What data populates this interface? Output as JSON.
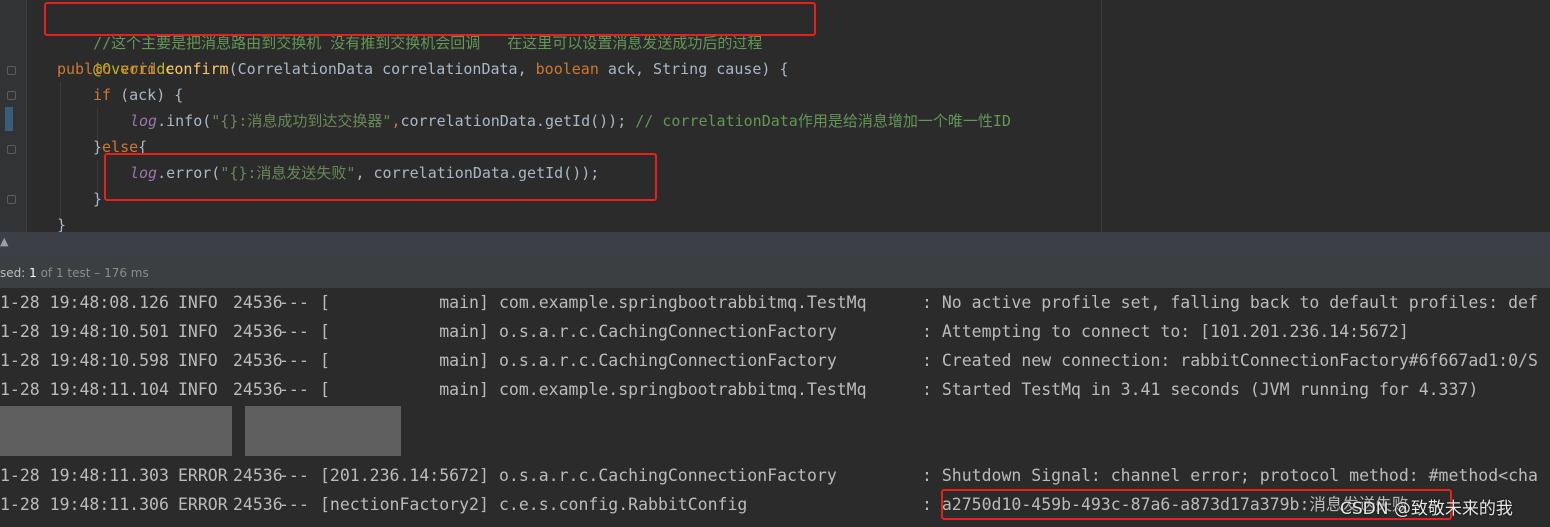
{
  "editor": {
    "lines": {
      "comment": "//这个主要是把消息路由到交换机 没有推到交换机会回调   在这里可以设置消息发送成功后的过程",
      "annotation": "@Override",
      "sig_public": "public",
      "sig_void": "void",
      "sig_name": "confirm",
      "sig_open": "(CorrelationData correlationData, ",
      "sig_boolean": "boolean",
      "sig_rest": " ack, String cause) {",
      "if_kw": "if",
      "if_rest": " (ack) {",
      "info_log": "log",
      "info_call": ".info(",
      "info_str": "\"{}:消息成功到达交换器\"",
      "info_comma": ",",
      "info_args": "correlationData.getId()); ",
      "info_comment": "// correlationData作用是给消息增加一个唯一性ID",
      "else_open": "}",
      "else_kw": "else",
      "else_brace": "{",
      "error_log": "log",
      "error_call": ".error(",
      "error_str": "\"{}:消息发送失败\"",
      "error_args": ", correlationData.getId());",
      "close_if": "}",
      "close_method": "}"
    }
  },
  "status": {
    "label": "sed: ",
    "value": "1",
    "rest": " of 1 test – 176 ms"
  },
  "console": {
    "rows": [
      {
        "date": "1-28 19:48:08.126",
        "level": "INFO",
        "pid": "24536",
        "sep": "---",
        "thread": "[           main]",
        "logger": "com.example.springbootrabbitmq.TestMq",
        "msg": ": No active profile set, falling back to default profiles: def"
      },
      {
        "date": "1-28 19:48:10.501",
        "level": "INFO",
        "pid": "24536",
        "sep": "---",
        "thread": "[           main]",
        "logger": "o.s.a.r.c.CachingConnectionFactory",
        "msg": ": Attempting to connect to: [101.201.236.14:5672]"
      },
      {
        "date": "1-28 19:48:10.598",
        "level": "INFO",
        "pid": "24536",
        "sep": "---",
        "thread": "[           main]",
        "logger": "o.s.a.r.c.CachingConnectionFactory",
        "msg": ": Created new connection: rabbitConnectionFactory#6f667ad1:0/S"
      },
      {
        "date": "1-28 19:48:11.104",
        "level": "INFO",
        "pid": "24536",
        "sep": "---",
        "thread": "[           main]",
        "logger": "com.example.springbootrabbitmq.TestMq",
        "msg": ": Started TestMq in 3.41 seconds (JVM running for 4.337)"
      },
      {
        "date": "1-28 19:48:11.303",
        "level": "ERROR",
        "pid": "24536",
        "sep": "---",
        "thread": "[201.236.14:5672]",
        "logger": "o.s.a.r.c.CachingConnectionFactory",
        "msg": ": Shutdown Signal: channel error; protocol method: #method<cha"
      },
      {
        "date": "1-28 19:48:11.306",
        "level": "ERROR",
        "pid": "24536",
        "sep": "---",
        "thread": "[nectionFactory2]",
        "logger": "c.e.s.config.RabbitConfig",
        "msg": ": a2750d10-459b-493c-87a6-a873d17a379b:消息发送失败"
      }
    ]
  },
  "watermark": "CSDN @致敬未来的我",
  "colors": {
    "editor_bg": "#2b2b2b",
    "highlight_box": "#e5211c",
    "keyword": "#cc7832",
    "string": "#6a8759",
    "method": "#ffc66d"
  }
}
